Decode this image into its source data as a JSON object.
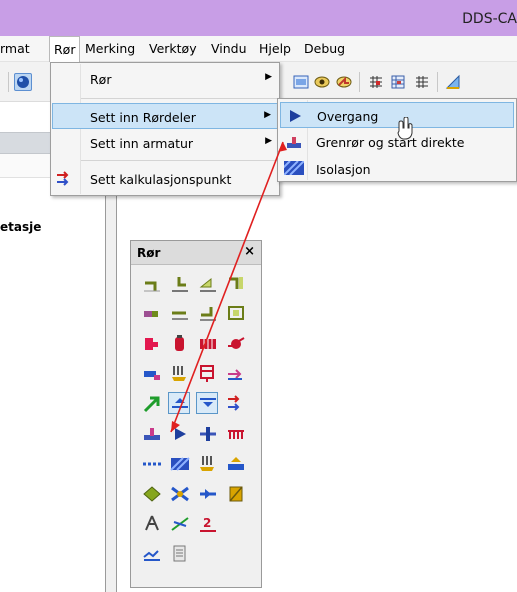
{
  "window": {
    "title": "DDS-CA"
  },
  "menubar": {
    "items": [
      {
        "label": "rmat"
      },
      {
        "label": "Rør"
      },
      {
        "label": "Merking"
      },
      {
        "label": "Verktøy"
      },
      {
        "label": "Vindu"
      },
      {
        "label": "Hjelp"
      },
      {
        "label": "Debug"
      }
    ]
  },
  "left_panel": {
    "text": "etasje"
  },
  "dropdown": {
    "items": [
      {
        "label": "Rør",
        "arrow": "▶"
      },
      {
        "label": "Sett inn Rørdeler",
        "arrow": "▶"
      },
      {
        "label": "Sett inn armatur",
        "arrow": "▶"
      },
      {
        "label": "Sett kalkulasjonspunkt"
      }
    ]
  },
  "submenu": {
    "items": [
      {
        "label": "Overgang",
        "icon": "play-triangle-icon"
      },
      {
        "label": "Grenrør og start direkte",
        "icon": "branch-pipe-icon"
      },
      {
        "label": "Isolasjon",
        "icon": "insulation-icon"
      }
    ]
  },
  "palette": {
    "title": "Rør",
    "close": "×"
  },
  "colors": {
    "titlebar": "#c89ee6",
    "highlight": "#cce4f7",
    "arrow": "#e02020"
  }
}
